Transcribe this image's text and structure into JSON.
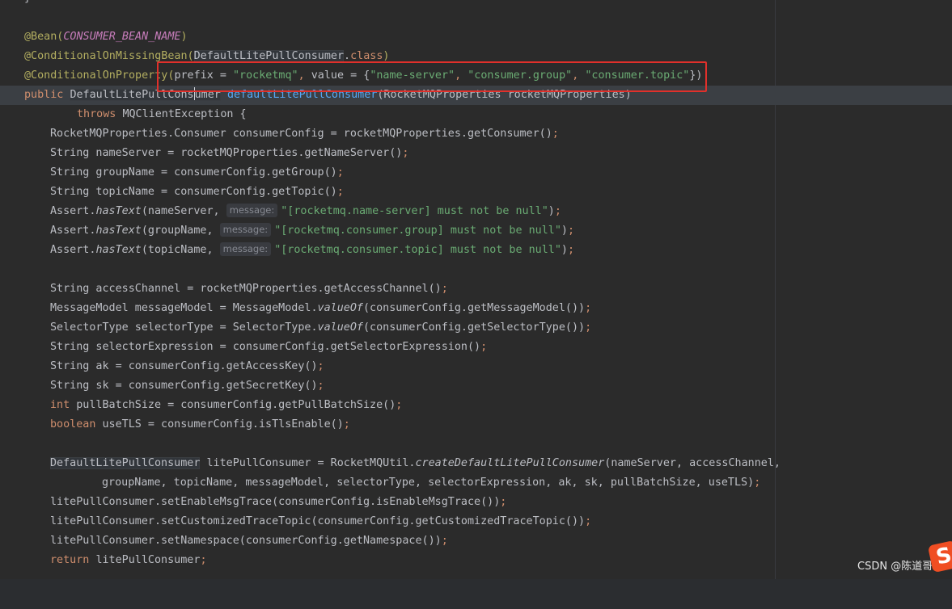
{
  "editor": {
    "lines": {
      "l0": "}",
      "l2_ann": "@Bean(",
      "l2_const": "CONSUMER_BEAN_NAME",
      "l2_close": ")",
      "l3_ann": "@ConditionalOnMissingBean(",
      "l3_type": "DefaultLitePullConsumer",
      "l3_dot": ".",
      "l3_class": "class",
      "l3_close": ")",
      "l4_ann": "@ConditionalOnProperty(",
      "l4_prefix": "prefix = ",
      "l4_s1": "\"rocketmq\"",
      "l4_c1": ", ",
      "l4_value": "value = {",
      "l4_s2": "\"name-server\"",
      "l4_c2": ", ",
      "l4_s3": "\"consumer.group\"",
      "l4_c3": ", ",
      "l4_s4": "\"consumer.topic\"",
      "l4_close": "})",
      "l5_kw": "public ",
      "l5_type_a": "DefaultLitePullCons",
      "l5_type_b": "umer",
      "l5_sp": " ",
      "l5_fn": "defaultLitePullConsumer",
      "l5_rest": "(RocketMQProperties rocketMQProperties)",
      "l6_kw": "throws ",
      "l6_rest": "MQClientException {",
      "l7": "RocketMQProperties.Consumer consumerConfig = rocketMQProperties.getConsumer()",
      "l8": "String nameServer = rocketMQProperties.getNameServer()",
      "l9": "String groupName = consumerConfig.getGroup()",
      "l10": "String topicName = consumerConfig.getTopic()",
      "l11_a": "Assert.",
      "l11_fn": "hasText",
      "l11_b": "(nameServer, ",
      "l11_hint": "message:",
      "l11_str": "\"[rocketmq.name-server] must not be null\"",
      "l12_a": "Assert.",
      "l12_fn": "hasText",
      "l12_b": "(groupName, ",
      "l12_hint": "message:",
      "l12_str": "\"[rocketmq.consumer.group] must not be null\"",
      "l13_a": "Assert.",
      "l13_fn": "hasText",
      "l13_b": "(topicName, ",
      "l13_hint": "message:",
      "l13_str": "\"[rocketmq.consumer.topic] must not be null\"",
      "l15": "String accessChannel = rocketMQProperties.getAccessChannel()",
      "l16_a": "MessageModel messageModel = MessageModel.",
      "l16_fn": "valueOf",
      "l16_b": "(consumerConfig.getMessageModel())",
      "l17_a": "SelectorType selectorType = SelectorType.",
      "l17_fn": "valueOf",
      "l17_b": "(consumerConfig.getSelectorType())",
      "l18": "String selectorExpression = consumerConfig.getSelectorExpression()",
      "l19": "String ak = consumerConfig.getAccessKey()",
      "l20": "String sk = consumerConfig.getSecretKey()",
      "l21_kw": "int ",
      "l21_rest": "pullBatchSize = consumerConfig.getPullBatchSize()",
      "l22_kw": "boolean ",
      "l22_rest": "useTLS = consumerConfig.isTlsEnable()",
      "l24_type": "DefaultLitePullConsumer",
      "l24_a": " litePullConsumer = RocketMQUtil.",
      "l24_fn": "createDefaultLitePullConsumer",
      "l24_b": "(nameServer, accessChannel,",
      "l25": "groupName, topicName, messageModel, selectorType, selectorExpression, ak, sk, pullBatchSize, useTLS)",
      "l26": "litePullConsumer.setEnableMsgTrace(consumerConfig.isEnableMsgTrace())",
      "l27": "litePullConsumer.setCustomizedTraceTopic(consumerConfig.getCustomizedTraceTopic())",
      "l28": "litePullConsumer.setNamespace(consumerConfig.getNamespace())",
      "l29_kw": "return ",
      "l29_rest": "litePullConsumer",
      "semi": ";"
    }
  },
  "watermark": "CSDN @陈道哥",
  "logo_letter": "S",
  "colors": {
    "background": "#2b2b2b",
    "annotation": "#b3ae60",
    "keyword": "#cf8e6d",
    "string": "#6aab73",
    "function": "#56a8f5",
    "constant": "#c77dbb",
    "highlight_box": "#e0302b"
  }
}
